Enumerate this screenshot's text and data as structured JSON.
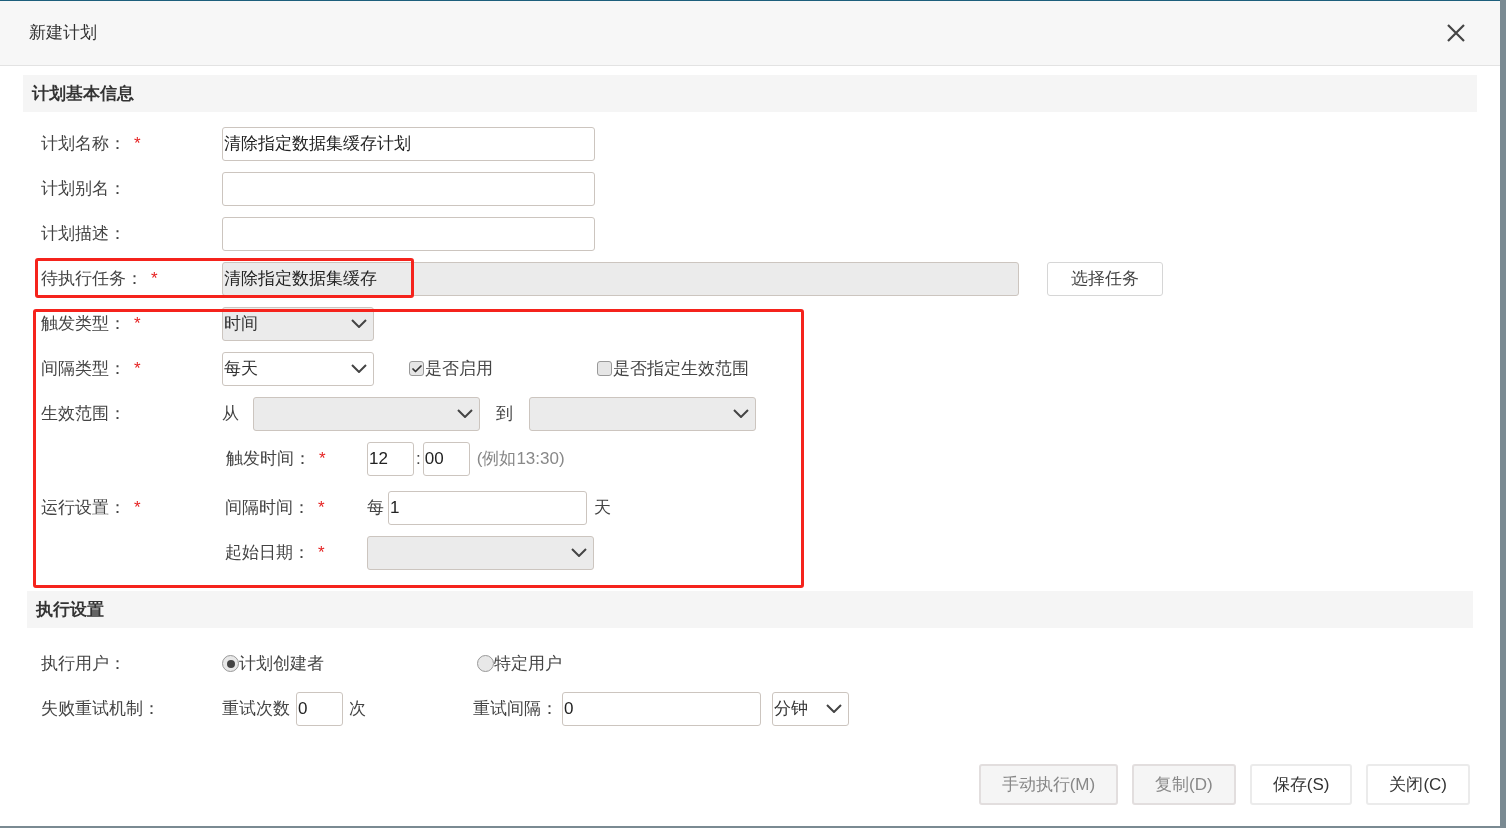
{
  "dialog": {
    "title": "新建计划"
  },
  "basic": {
    "title": "计划基本信息",
    "name": {
      "label": "计划名称：",
      "mark": "*",
      "value": "清除指定数据集缓存计划"
    },
    "alias": {
      "label": "计划别名："
    },
    "description": {
      "label": "计划描述："
    },
    "task": {
      "label": "待执行任务：",
      "mark": "*",
      "value": "清除指定数据集缓存",
      "disabled": true,
      "button": "选择任务"
    },
    "trigger_type": {
      "label": "触发类型：",
      "mark": "*",
      "value": "时间",
      "disabled": true
    },
    "interval_type": {
      "label": "间隔类型：",
      "mark": "*",
      "value": "每天",
      "disabled": false
    },
    "checkboxes": [
      {
        "label": "是否启用",
        "checked": true
      },
      {
        "label": "是否指定生效范围",
        "checked": false
      }
    ],
    "range": {
      "label": "生效范围：",
      "from_label": "从",
      "to_label": "到",
      "disabled": true
    },
    "trigger_time": {
      "label": "触发时间：",
      "mark": "*",
      "hour": "12",
      "separator": ":",
      "minute": "00",
      "hint": "(例如13:30)"
    },
    "run": {
      "label": "运行设置：",
      "mark": "*",
      "interval_label": "间隔时间：",
      "interval_mark": "*",
      "prefix": "每",
      "value": "1",
      "unit": "天"
    },
    "start_date": {
      "label": "起始日期：",
      "mark": "*",
      "disabled": true
    }
  },
  "execution": {
    "title": "执行设置",
    "user": {
      "label": "执行用户：",
      "options": [
        {
          "label": "计划创建者",
          "selected": true
        },
        {
          "label": "特定用户",
          "selected": false
        }
      ]
    },
    "retry": {
      "label": "失败重试机制：",
      "count_label": "重试次数",
      "count": "0",
      "count_unit": "次",
      "interval_label": "重试间隔：",
      "interval": "0",
      "unit": "分钟"
    }
  },
  "buttons": [
    {
      "label": "手动执行(M)",
      "disabled": true
    },
    {
      "label": "复制(D)",
      "disabled": true
    },
    {
      "label": "保存(S)",
      "disabled": false
    },
    {
      "label": "关闭(C)",
      "disabled": false
    }
  ]
}
